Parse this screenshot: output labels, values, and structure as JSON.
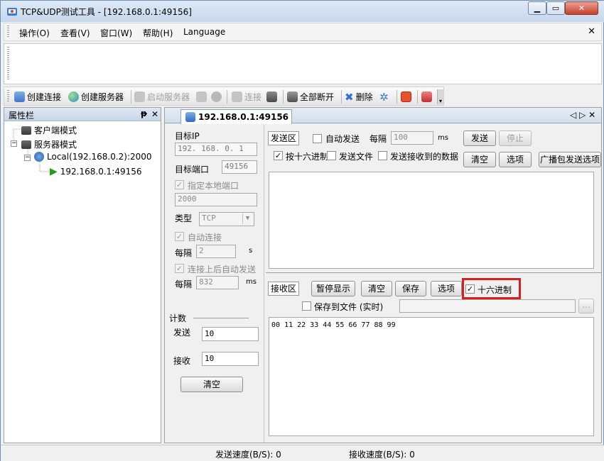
{
  "window": {
    "title": "TCP&UDP测试工具 - [192.168.0.1:49156]",
    "buttons": {
      "minimize": "▁",
      "maximize": "▭",
      "close": "✕"
    }
  },
  "menu": {
    "items": [
      "操作(O)",
      "查看(V)",
      "窗口(W)",
      "帮助(H)",
      "Language"
    ],
    "mdi_close": "✕"
  },
  "toolbar": {
    "create_connection": "创建连接",
    "create_server": "创建服务器",
    "start_server": "启动服务器",
    "connect": "连接",
    "disconnect_all": "全部断开",
    "delete": "删除"
  },
  "left_panel": {
    "title": "属性栏",
    "pin": "ᵽ",
    "close": "✕",
    "tree": {
      "client_mode": "客户端模式",
      "server_mode": "服务器模式",
      "local_server": "Local(192.168.0.2):2000",
      "connection": "192.168.0.1:49156"
    }
  },
  "doc": {
    "tab_label": "192.168.0.1:49156",
    "nav": "◁ ▷ ✕"
  },
  "config": {
    "target_ip_label": "目标IP",
    "target_ip_value": "192. 168. 0. 1",
    "target_port_label": "目标端口",
    "target_port_value": "49156",
    "local_port_label": "指定本地端口",
    "local_port_value": "2000",
    "type_label": "类型",
    "type_value": "TCP",
    "auto_connect_label": "自动连接",
    "every_label": "每隔",
    "auto_connect_interval": "2",
    "auto_connect_unit": "s",
    "auto_send_after_connect_label": "连接上后自动发送",
    "every_label2": "每隔",
    "auto_send_interval": "832",
    "auto_send_unit": "ms"
  },
  "count": {
    "title": "计数",
    "send_label": "发送",
    "send_value": "10",
    "recv_label": "接收",
    "recv_value": "10",
    "clear_label": "清空"
  },
  "send_area": {
    "label": "发送区",
    "auto_send_label": "自动发送",
    "every_label": "每隔",
    "interval_value": "100",
    "interval_unit": "ms",
    "send_button": "发送",
    "stop_button": "停止",
    "hex_label": "按十六进制",
    "hex_checked": true,
    "send_file_label": "发送文件",
    "send_received_label": "发送接收到的数据",
    "clear_button": "清空",
    "options_button": "选项",
    "broadcast_button": "广播包发送选项",
    "content": ""
  },
  "recv_area": {
    "label": "接收区",
    "pause_button": "暂停显示",
    "clear_button": "清空",
    "save_button": "保存",
    "options_button": "选项",
    "hex_label": "十六进制",
    "hex_checked": true,
    "save_to_file_label": "保存到文件 (实时)",
    "file_path": "",
    "browse_button": "...",
    "content": "00 11 22 33 44 55 66 77 88 99"
  },
  "status": {
    "send_speed": "发送速度(B/S): 0",
    "recv_speed": "接收速度(B/S): 0"
  }
}
